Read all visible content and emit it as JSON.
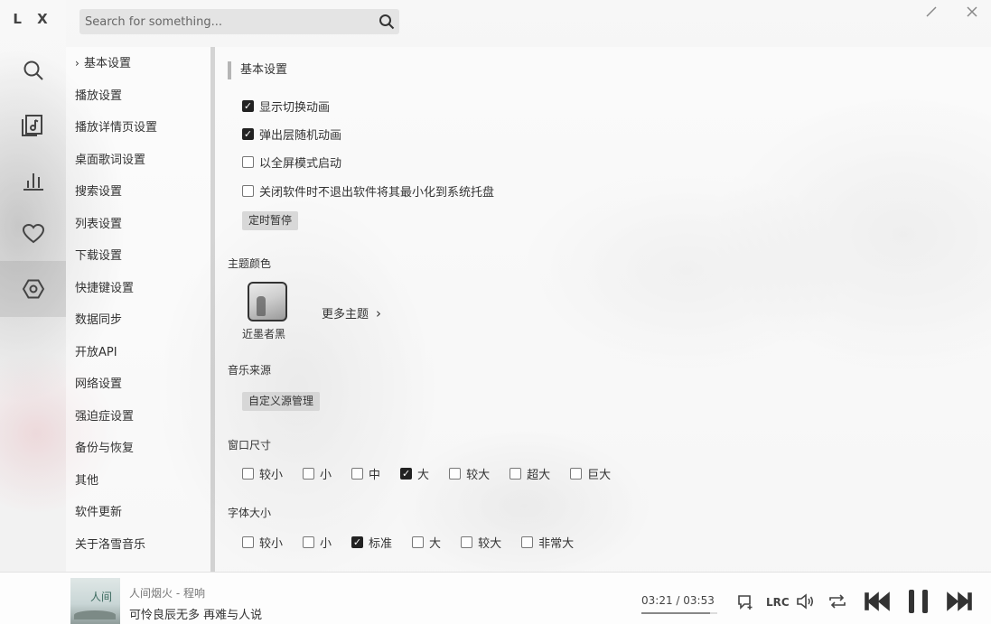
{
  "app": {
    "logo": "L X"
  },
  "search": {
    "placeholder": "Search for something..."
  },
  "rail": {
    "items": [
      {
        "name": "search",
        "icon": "search-icon"
      },
      {
        "name": "song-list",
        "icon": "music-note-icon"
      },
      {
        "name": "leaderboard",
        "icon": "bar-chart-icon"
      },
      {
        "name": "favorites",
        "icon": "heart-icon"
      },
      {
        "name": "settings",
        "icon": "settings-hexagon-icon",
        "active": true
      }
    ]
  },
  "nav": {
    "items": [
      {
        "label": "基本设置",
        "active": true,
        "marker": "›"
      },
      {
        "label": "播放设置"
      },
      {
        "label": "播放详情页设置"
      },
      {
        "label": "桌面歌词设置"
      },
      {
        "label": "搜索设置"
      },
      {
        "label": "列表设置"
      },
      {
        "label": "下载设置"
      },
      {
        "label": "快捷键设置"
      },
      {
        "label": "数据同步"
      },
      {
        "label": "开放API"
      },
      {
        "label": "网络设置"
      },
      {
        "label": "强迫症设置"
      },
      {
        "label": "备份与恢复"
      },
      {
        "label": "其他"
      },
      {
        "label": "软件更新"
      },
      {
        "label": "关于洛雪音乐"
      }
    ]
  },
  "basic": {
    "title": "基本设置",
    "options": [
      {
        "label": "显示切换动画",
        "checked": true
      },
      {
        "label": "弹出层随机动画",
        "checked": true
      },
      {
        "label": "以全屏模式启动",
        "checked": false
      },
      {
        "label": "关闭软件时不退出软件将其最小化到系统托盘",
        "checked": false
      }
    ],
    "timer_button": "定时暂停"
  },
  "theme": {
    "label": "主题颜色",
    "current_name": "近墨者黑",
    "more_label": "更多主题",
    "more_arrow": "›"
  },
  "source": {
    "label": "音乐来源",
    "button": "自定义源管理"
  },
  "window_size": {
    "label": "窗口尺寸",
    "options": [
      {
        "label": "较小",
        "checked": false
      },
      {
        "label": "小",
        "checked": false
      },
      {
        "label": "中",
        "checked": false
      },
      {
        "label": "大",
        "checked": true
      },
      {
        "label": "较大",
        "checked": false
      },
      {
        "label": "超大",
        "checked": false
      },
      {
        "label": "巨大",
        "checked": false
      }
    ]
  },
  "font_size": {
    "label": "字体大小",
    "options": [
      {
        "label": "较小",
        "checked": false
      },
      {
        "label": "小",
        "checked": false
      },
      {
        "label": "标准",
        "checked": true
      },
      {
        "label": "大",
        "checked": false
      },
      {
        "label": "较大",
        "checked": false
      },
      {
        "label": "非常大",
        "checked": false
      }
    ]
  },
  "player": {
    "cover_text": "人间",
    "title": "人间烟火 - 程响",
    "lyric": "可怜良辰无多 再难与人说",
    "time": "03:21 / 03:53",
    "progress": 0.907,
    "lrc_label": "LRC"
  }
}
